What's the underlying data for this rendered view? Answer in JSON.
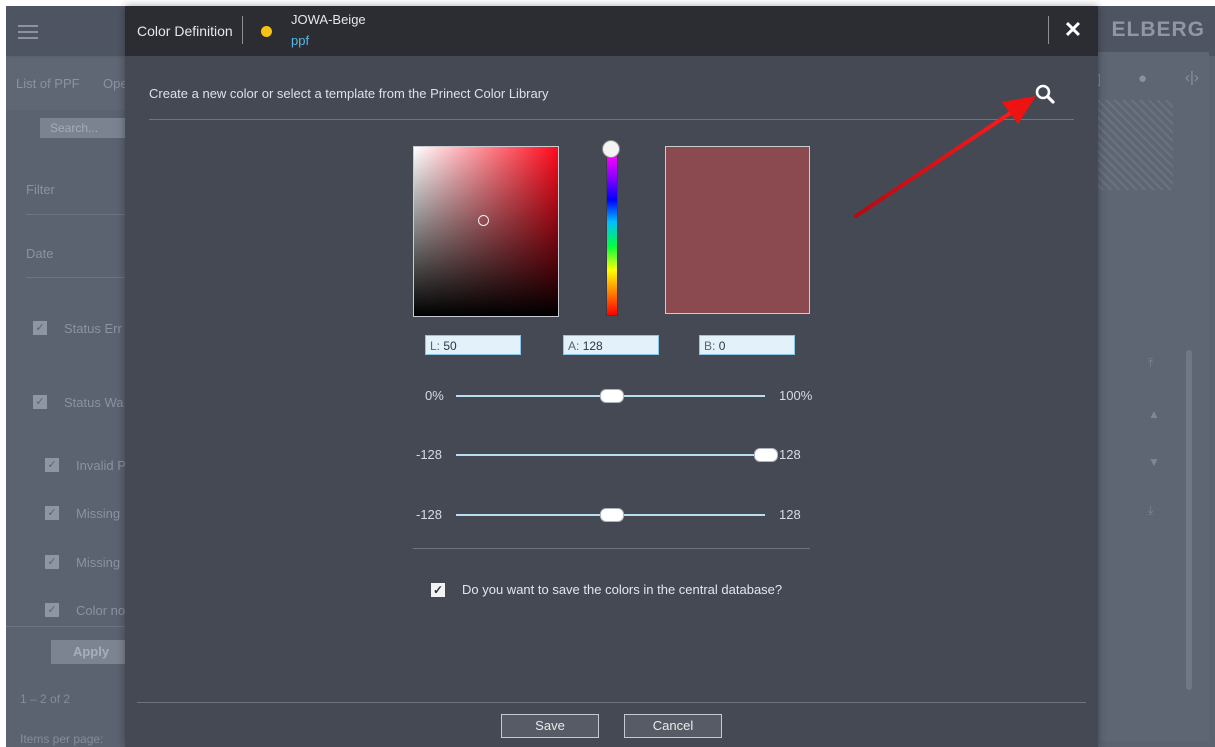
{
  "background": {
    "brand": "ELBERG",
    "tabs": [
      "List of PPF",
      "Ope"
    ],
    "search_placeholder": "Search...",
    "filter_label": "Filter",
    "date_label": "Date",
    "checkbox_items": [
      "Status Err",
      "Status Wa",
      "Invalid P",
      "Missing",
      "Missing",
      "Color no"
    ],
    "apply_label": "Apply",
    "pager_range": "1 – 2 of 2",
    "items_per_page": "Items per page:"
  },
  "dialog": {
    "title": "Color Definition",
    "color_name": "JOWA-Beige",
    "color_type": "ppf",
    "close_icon": "close-icon",
    "subtitle": "Create a new color or select a template from the Prinect Color Library",
    "search_icon": "search-icon",
    "preview_color": "#8b4a4f",
    "lab": {
      "l_prefix": "L:",
      "l_value": "50",
      "a_prefix": "A:",
      "a_value": "128",
      "b_prefix": "B:",
      "b_value": "0"
    },
    "sliders": [
      {
        "min_label": "0%",
        "max_label": "100%",
        "value_fraction": 0.5
      },
      {
        "min_label": "-128",
        "max_label": "128",
        "value_fraction": 1.0
      },
      {
        "min_label": "-128",
        "max_label": "128",
        "value_fraction": 0.5
      }
    ],
    "save_checkbox_checked": true,
    "save_checkbox_label": "Do you want to save the colors in the central database?",
    "save_button": "Save",
    "cancel_button": "Cancel"
  },
  "colors": {
    "accent_yellow": "#f5c313",
    "link_blue": "#5cb6e8",
    "arrow_red": "#e8131b"
  }
}
